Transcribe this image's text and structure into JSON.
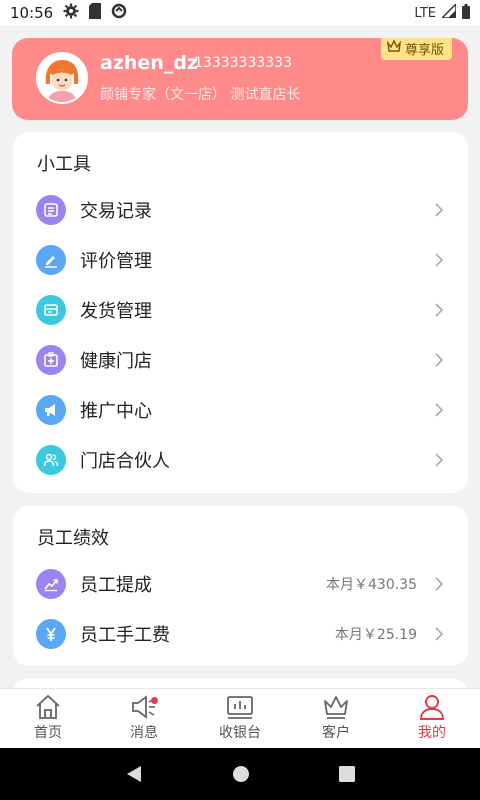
{
  "status_bar": {
    "time": "10:56",
    "network": "LTE"
  },
  "profile": {
    "name": "azhen_dz",
    "phone": "13333333333",
    "role": "颜铺专家（文一店） 测试直店长",
    "badge": "尊享版"
  },
  "tools": {
    "title": "小工具",
    "items": [
      {
        "label": "交易记录",
        "icon": "document-icon",
        "color": "#9b84f0"
      },
      {
        "label": "评价管理",
        "icon": "edit-icon",
        "color": "#5aa7f5"
      },
      {
        "label": "发货管理",
        "icon": "delivery-icon",
        "color": "#3cc8e0"
      },
      {
        "label": "健康门店",
        "icon": "medical-kit-icon",
        "color": "#9b84f0"
      },
      {
        "label": "推广中心",
        "icon": "megaphone-icon",
        "color": "#5aa7f5"
      },
      {
        "label": "门店合伙人",
        "icon": "partners-icon",
        "color": "#3cc8e0"
      }
    ]
  },
  "performance": {
    "title": "员工绩效",
    "items": [
      {
        "label": "员工提成",
        "value": "本月￥430.35",
        "icon": "chart-up-icon",
        "color": "#9b84f0"
      },
      {
        "label": "员工手工费",
        "value": "本月￥25.19",
        "icon": "yen-icon",
        "color": "#5aa7f5"
      }
    ]
  },
  "tabs": [
    {
      "label": "首页",
      "icon": "home-icon"
    },
    {
      "label": "消息",
      "icon": "message-speaker-icon"
    },
    {
      "label": "收银台",
      "icon": "cashier-icon"
    },
    {
      "label": "客户",
      "icon": "crown-icon"
    },
    {
      "label": "我的",
      "icon": "user-icon"
    }
  ],
  "colors": {
    "accent": "#e53946",
    "profile_bg": "#ff8a8a",
    "badge_bg": "#ffe38a"
  }
}
